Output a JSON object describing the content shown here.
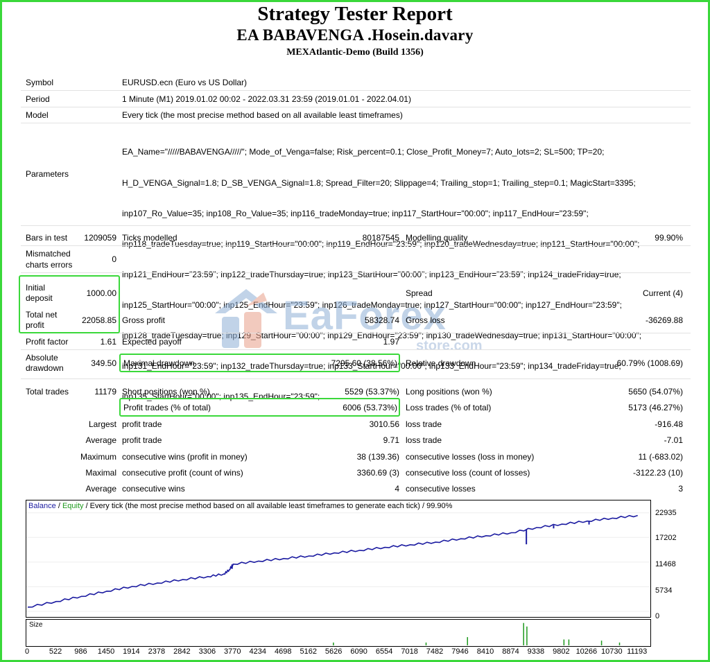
{
  "header": {
    "title": "Strategy Tester Report",
    "ea_name": "EA BABAVENGA .Hosein.davary",
    "server": "MEXAtlantic-Demo (Build 1356)"
  },
  "info": {
    "symbol_label": "Symbol",
    "symbol_value": "EURUSD.ecn (Euro vs US Dollar)",
    "period_label": "Period",
    "period_value": "1 Minute (M1) 2019.01.02 00:02 - 2022.03.31 23:59 (2019.01.01 - 2022.04.01)",
    "model_label": "Model",
    "model_value": "Every tick (the most precise method based on all available least timeframes)",
    "parameters_label": "Parameters",
    "parameters_lines": [
      "EA_Name=\"/////BABAVENGA/////\"; Mode_of_Venga=false; Risk_percent=0.1; Close_Profit_Money=7; Auto_lots=2; SL=500; TP=20;",
      "H_D_VENGA_Signal=1.8; D_SB_VENGA_Signal=1.8; Spread_Filter=20; Slippage=4; Trailing_stop=1; Trailing_step=0.1; MagicStart=3395;",
      "inp107_Ro_Value=35; inp108_Ro_Value=35; inp116_tradeMonday=true; inp117_StartHour=\"00:00\"; inp117_EndHour=\"23:59\";",
      "inp118_tradeTuesday=true; inp119_StartHour=\"00:00\"; inp119_EndHour=\"23:59\"; inp120_tradeWednesday=true; inp121_StartHour=\"00:00\";",
      "inp121_EndHour=\"23:59\"; inp122_tradeThursday=true; inp123_StartHour=\"00:00\"; inp123_EndHour=\"23:59\"; inp124_tradeFriday=true;",
      "inp125_StartHour=\"00:00\"; inp125_EndHour=\"23:59\"; inp126_tradeMonday=true; inp127_StartHour=\"00:00\"; inp127_EndHour=\"23:59\";",
      "inp128_tradeTuesday=true; inp129_StartHour=\"00:00\"; inp129_EndHour=\"23:59\"; inp130_tradeWednesday=true; inp131_StartHour=\"00:00\";",
      "inp131_EndHour=\"23:59\"; inp132_tradeThursday=true; inp133_StartHour=\"00:00\"; inp133_EndHour=\"23:59\"; inp134_tradeFriday=true;",
      "inp135_StartHour=\"00:00\"; inp135_EndHour=\"23:59\";"
    ]
  },
  "stats": {
    "bars_label": "Bars in test",
    "bars_value": "1209059",
    "ticks_label": "Ticks modelled",
    "ticks_value": "80187545",
    "quality_label": "Modelling quality",
    "quality_value": "99.90%",
    "mismatch_label_1": "Mismatched",
    "mismatch_label_2": "charts errors",
    "mismatch_value": "0",
    "deposit_label_1": "Initial",
    "deposit_label_2": "deposit",
    "deposit_value": "1000.00",
    "spread_label": "Spread",
    "spread_value": "Current (4)",
    "net_label_1": "Total net",
    "net_label_2": "profit",
    "net_value": "22058.85",
    "gross_profit_label": "Gross profit",
    "gross_profit_value": "58328.74",
    "gross_loss_label": "Gross loss",
    "gross_loss_value": "-36269.88",
    "pf_label": "Profit factor",
    "pf_value": "1.61",
    "payoff_label": "Expected payoff",
    "payoff_value": "1.97",
    "absdd_label_1": "Absolute",
    "absdd_label_2": "drawdown",
    "absdd_value": "349.50",
    "maxdd_label": "Maximal drawdown",
    "maxdd_value": "7295.60 (38.56%)",
    "reldd_label": "Relative drawdown",
    "reldd_value": "60.79% (1008.69)",
    "trades_label": "Total trades",
    "trades_value": "11179",
    "short_label": "Short positions (won %)",
    "short_value": "5529 (53.37%)",
    "long_label": "Long positions (won %)",
    "long_value": "5650 (54.07%)",
    "profit_trades_label": "Profit trades (% of total)",
    "profit_trades_value": "6006 (53.73%)",
    "loss_trades_label": "Loss trades (% of total)",
    "loss_trades_value": "5173 (46.27%)",
    "largest_label": "Largest",
    "largest_profit_label": "profit trade",
    "largest_profit_value": "3010.56",
    "largest_loss_label": "loss trade",
    "largest_loss_value": "-916.48",
    "average_label": "Average",
    "average_profit_label": "profit trade",
    "average_profit_value": "9.71",
    "average_loss_label": "loss trade",
    "average_loss_value": "-7.01",
    "maximum_label": "Maximum",
    "max_wins_label": "consecutive wins (profit in money)",
    "max_wins_value": "38 (139.36)",
    "max_losses_label": "consecutive losses (loss in money)",
    "max_losses_value": "11 (-683.02)",
    "maximal_label": "Maximal",
    "maximal_profit_label": "consecutive profit (count of wins)",
    "maximal_profit_value": "3360.69 (3)",
    "maximal_loss_label": "consecutive loss (count of losses)",
    "maximal_loss_value": "-3122.23 (10)",
    "avg_cons_label": "Average",
    "avg_wins_label": "consecutive wins",
    "avg_wins_value": "4",
    "avg_losses_label": "consecutive losses",
    "avg_losses_value": "3"
  },
  "watermark": {
    "main": "EaForex",
    "sub": "store.com"
  },
  "chart_caption": {
    "balance": "Balance",
    "slash": " / ",
    "equity": "Equity",
    "rest": " / Every tick (the most precise method based on all available least timeframes to generate each tick) / 99.90%"
  },
  "size_label": "Size",
  "chart_data": {
    "type": "line",
    "series": [
      {
        "name": "Balance",
        "color": "#1a1aa0"
      },
      {
        "name": "Equity",
        "color": "#1e9a1e"
      }
    ],
    "y_ticks": [
      "22935",
      "17202",
      "11468",
      "5734",
      "0"
    ],
    "y_tick_values": [
      22935,
      17202,
      11468,
      5734,
      0
    ],
    "x_ticks": [
      "0",
      "522",
      "986",
      "1450",
      "1914",
      "2378",
      "2842",
      "3306",
      "3770",
      "4234",
      "4698",
      "5162",
      "5626",
      "6090",
      "6554",
      "7018",
      "7482",
      "7946",
      "8410",
      "8874",
      "9338",
      "9802",
      "10266",
      "10730",
      "11193"
    ],
    "x_tick_values": [
      0,
      522,
      986,
      1450,
      1914,
      2378,
      2842,
      3306,
      3770,
      4234,
      4698,
      5162,
      5626,
      6090,
      6554,
      7018,
      7482,
      7946,
      8410,
      8874,
      9338,
      9802,
      10266,
      10730,
      11193
    ],
    "ylim": [
      0,
      24500
    ],
    "xlim": [
      0,
      11400
    ],
    "x": [
      0,
      522,
      986,
      1450,
      1914,
      2378,
      2842,
      3306,
      3600,
      3700,
      3770,
      4234,
      4698,
      5162,
      5626,
      6090,
      6554,
      7018,
      7482,
      7946,
      8410,
      8874,
      9338,
      9802,
      10266,
      10730,
      11193
    ],
    "balance": [
      1000,
      2300,
      3500,
      4700,
      5800,
      6600,
      7400,
      8100,
      8700,
      9700,
      11000,
      11700,
      12300,
      12900,
      13600,
      14200,
      14900,
      15500,
      16100,
      16900,
      17600,
      18300,
      19500,
      20300,
      21000,
      21700,
      22300
    ],
    "balance_spikes": [
      {
        "x": 9150,
        "y": 15600
      },
      {
        "x": 9650,
        "y": 19300
      },
      {
        "x": 10300,
        "y": 20200
      },
      {
        "x": 3750,
        "y": 9900
      }
    ],
    "size_bars": [
      {
        "x": 8060,
        "h": 0.35
      },
      {
        "x": 9090,
        "h": 0.95
      },
      {
        "x": 9150,
        "h": 0.8
      },
      {
        "x": 9830,
        "h": 0.25
      },
      {
        "x": 9920,
        "h": 0.25
      },
      {
        "x": 10520,
        "h": 0.2
      },
      {
        "x": 5600,
        "h": 0.12
      },
      {
        "x": 7300,
        "h": 0.12
      },
      {
        "x": 10850,
        "h": 0.12
      }
    ]
  }
}
